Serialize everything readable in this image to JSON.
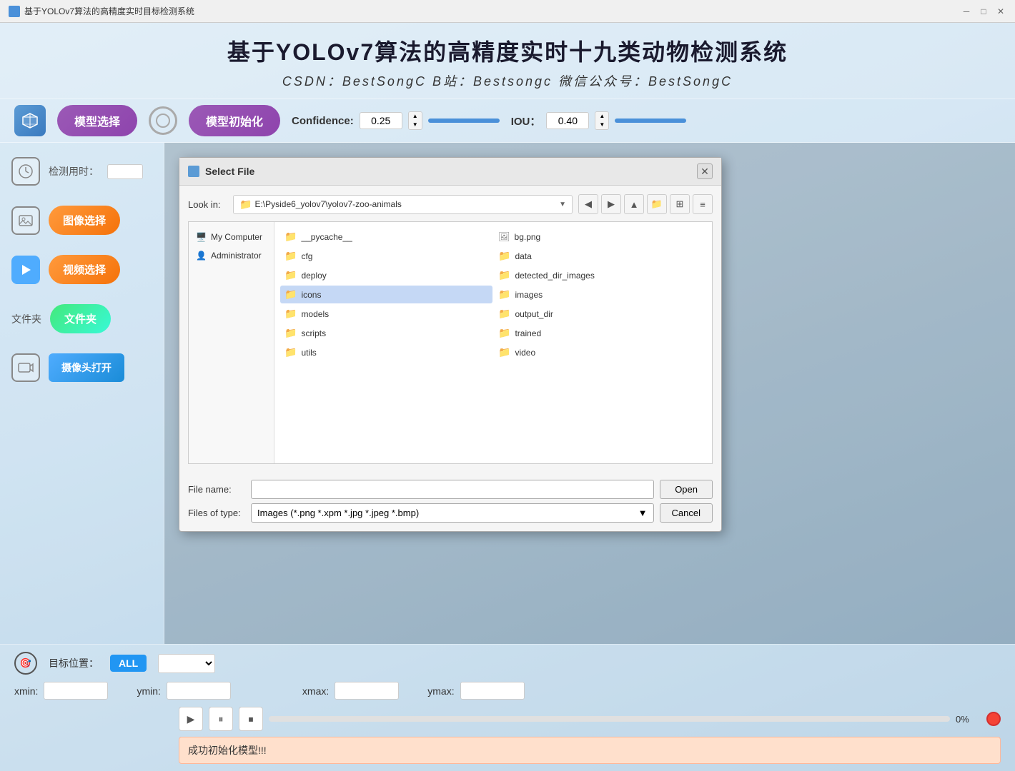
{
  "titleBar": {
    "title": "基于YOLOv7算法的高精度实时目标检测系统",
    "icon": "app-icon"
  },
  "header": {
    "title": "基于YOLOv7算法的高精度实时十九类动物检测系统",
    "subtitle": "CSDN：BestSongC   B站：Bestsongc   微信公众号：BestSongC"
  },
  "toolbar": {
    "modelSelectBtn": "模型选择",
    "modelInitBtn": "模型初始化",
    "confidenceLabel": "Confidence:",
    "confidenceValue": "0.25",
    "iouLabel": "IOU：",
    "iouValue": "0.40"
  },
  "sidebar": {
    "detectTimeLabel": "检测用时：",
    "imageSelectBtn": "图像选择",
    "videoSelectBtn": "视频选择",
    "folderLabel": "文件夹",
    "folderBtn": "文件夹",
    "cameraBtn": "摄像头打开"
  },
  "bottomPanel": {
    "targetLabel": "目标位置：",
    "allBadge": "ALL",
    "xminLabel": "xmin:",
    "yminLabel": "ymin:",
    "xmaxLabel": "xmax:",
    "ymaxLabel": "ymax:",
    "progressPercent": "0%",
    "statusText": "成功初始化模型!!!"
  },
  "dialog": {
    "title": "Select File",
    "lookInLabel": "Look in:",
    "currentPath": "E:\\Pyside6_yolov7\\yolov7-zoo-animals",
    "places": [
      {
        "id": "my-computer",
        "label": "My Computer"
      },
      {
        "id": "administrator",
        "label": "Administrator"
      }
    ],
    "files": [
      {
        "name": "__pycache__",
        "type": "folder"
      },
      {
        "name": "bg.png",
        "type": "image"
      },
      {
        "name": "cfg",
        "type": "folder"
      },
      {
        "name": "data",
        "type": "folder"
      },
      {
        "name": "deploy",
        "type": "folder"
      },
      {
        "name": "detected_dir_images",
        "type": "folder"
      },
      {
        "name": "icons",
        "type": "folder",
        "selected": true
      },
      {
        "name": "images",
        "type": "folder"
      },
      {
        "name": "models",
        "type": "folder"
      },
      {
        "name": "output_dir",
        "type": "folder"
      },
      {
        "name": "scripts",
        "type": "folder"
      },
      {
        "name": "trained",
        "type": "folder"
      },
      {
        "name": "utils",
        "type": "folder"
      },
      {
        "name": "video",
        "type": "folder"
      }
    ],
    "fileNameLabel": "File name:",
    "fileNameValue": "",
    "openBtnLabel": "Open",
    "filesOfTypeLabel": "Files of type:",
    "filesOfTypeValue": "Images (*.png *.xpm *.jpg *.jpeg *.bmp)",
    "cancelBtnLabel": "Cancel"
  }
}
